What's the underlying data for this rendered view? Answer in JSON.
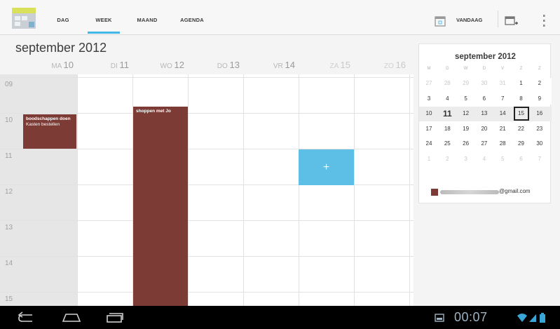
{
  "tabs": [
    {
      "label": "DAG",
      "active": false
    },
    {
      "label": "WEEK",
      "active": true
    },
    {
      "label": "MAAND",
      "active": false
    },
    {
      "label": "AGENDA",
      "active": false
    }
  ],
  "toolbar": {
    "today_label": "VANDAAG",
    "icons": [
      "calendar-app-icon",
      "calendar-today-icon",
      "new-event-icon",
      "overflow-menu-icon"
    ]
  },
  "week": {
    "month_title": "september 2012",
    "days": [
      {
        "dow": "MA",
        "num": "10"
      },
      {
        "dow": "DI",
        "num": "11"
      },
      {
        "dow": "WO",
        "num": "12"
      },
      {
        "dow": "DO",
        "num": "13"
      },
      {
        "dow": "VR",
        "num": "14"
      },
      {
        "dow": "ZA",
        "num": "15"
      },
      {
        "dow": "ZO",
        "num": "16"
      }
    ],
    "hours": [
      "09",
      "10",
      "11",
      "12",
      "13",
      "14",
      "15"
    ],
    "events": [
      {
        "title": "boodschappen doen",
        "location": "Kasten bestellen",
        "day": "MA 10"
      },
      {
        "title": "shoppen met Jo",
        "day": "WO 12"
      }
    ],
    "new_event_symbol": "+",
    "colors": {
      "event": "#7d3b35",
      "selection": "#5dbfe6",
      "accent": "#42b6e7"
    }
  },
  "mini_month": {
    "title": "september 2012",
    "weekdays": [
      "M",
      "D",
      "W",
      "D",
      "V",
      "Z",
      "Z"
    ],
    "weeks": [
      [
        "27",
        "28",
        "29",
        "30",
        "31",
        "1",
        "2"
      ],
      [
        "3",
        "4",
        "5",
        "6",
        "7",
        "8",
        "9"
      ],
      [
        "10",
        "11",
        "12",
        "13",
        "14",
        "15",
        "16"
      ],
      [
        "17",
        "18",
        "19",
        "20",
        "21",
        "22",
        "23"
      ],
      [
        "24",
        "25",
        "26",
        "27",
        "28",
        "29",
        "30"
      ],
      [
        "1",
        "2",
        "3",
        "4",
        "5",
        "6",
        "7"
      ]
    ],
    "today": "15",
    "account_label": "@gmail.com"
  },
  "statusbar": {
    "time": "00:07",
    "icons": [
      "back-icon",
      "home-icon",
      "recent-apps-icon",
      "screenshot-icon",
      "wifi-icon",
      "signal-icon",
      "battery-icon"
    ]
  }
}
